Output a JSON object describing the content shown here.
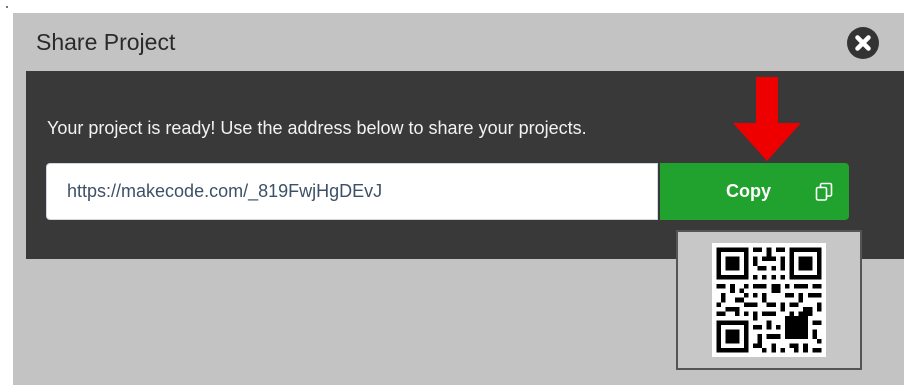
{
  "dialog": {
    "title": "Share Project",
    "message": "Your project is ready! Use the address below to share your projects.",
    "share_url": "https://makecode.com/_819FwjHgDEvJ",
    "copy_label": "Copy"
  },
  "icons": {
    "close": "close-icon",
    "copy": "copy-icon",
    "arrow": "down-arrow-icon",
    "qr": "qr-code"
  },
  "colors": {
    "header_bg": "#c3c3c3",
    "body_bg": "#393939",
    "copy_button": "#21a12d",
    "arrow": "#ee0000",
    "url_text": "#3d5166"
  }
}
